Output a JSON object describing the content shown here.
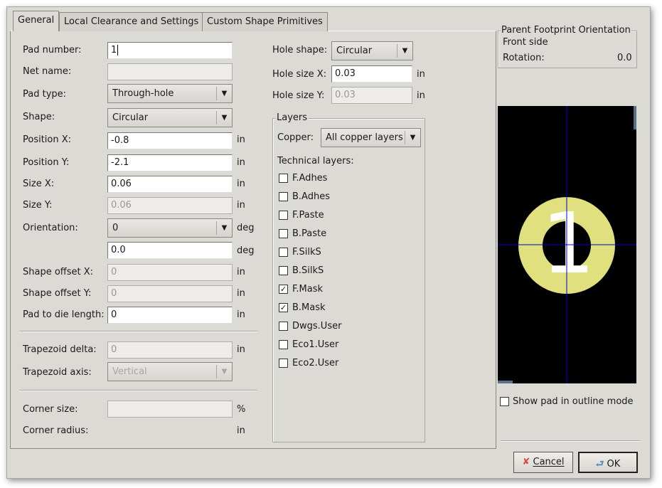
{
  "tabs": [
    "General",
    "Local Clearance and Settings",
    "Custom Shape Primitives"
  ],
  "left": {
    "pad_number": {
      "label": "Pad number:",
      "value": "1"
    },
    "net_name": {
      "label": "Net name:",
      "value": ""
    },
    "pad_type": {
      "label": "Pad type:",
      "value": "Through-hole"
    },
    "shape": {
      "label": "Shape:",
      "value": "Circular"
    },
    "position_x": {
      "label": "Position X:",
      "value": "-0.8",
      "unit": "in"
    },
    "position_y": {
      "label": "Position Y:",
      "value": "-2.1",
      "unit": "in"
    },
    "size_x": {
      "label": "Size X:",
      "value": "0.06",
      "unit": "in"
    },
    "size_y": {
      "label": "Size Y:",
      "value": "0.06",
      "unit": "in"
    },
    "orientation": {
      "label": "Orientation:",
      "value": "0",
      "unit": "deg",
      "custom_value": "0.0",
      "custom_unit": "deg"
    },
    "shape_offset_x": {
      "label": "Shape offset X:",
      "value": "0",
      "unit": "in"
    },
    "shape_offset_y": {
      "label": "Shape offset Y:",
      "value": "0",
      "unit": "in"
    },
    "pad_to_die": {
      "label": "Pad to die length:",
      "value": "0",
      "unit": "in"
    },
    "trapezoid_delta": {
      "label": "Trapezoid delta:",
      "value": "0",
      "unit": "in"
    },
    "trapezoid_axis": {
      "label": "Trapezoid axis:",
      "value": "Vertical"
    },
    "corner_size": {
      "label": "Corner size:",
      "value": "",
      "unit": "%"
    },
    "corner_radius": {
      "label": "Corner radius:",
      "unit": "in"
    }
  },
  "middle": {
    "hole_shape": {
      "label": "Hole shape:",
      "value": "Circular"
    },
    "hole_size_x": {
      "label": "Hole size X:",
      "value": "0.03",
      "unit": "in"
    },
    "hole_size_y": {
      "label": "Hole size Y:",
      "value": "0.03",
      "unit": "in"
    },
    "layers": {
      "title": "Layers",
      "copper_label": "Copper:",
      "copper_value": "All copper layers",
      "technical_label": "Technical layers:",
      "items": [
        {
          "name": "F.Adhes",
          "checked": false
        },
        {
          "name": "B.Adhes",
          "checked": false
        },
        {
          "name": "F.Paste",
          "checked": false
        },
        {
          "name": "B.Paste",
          "checked": false
        },
        {
          "name": "F.SilkS",
          "checked": false
        },
        {
          "name": "B.SilkS",
          "checked": false
        },
        {
          "name": "F.Mask",
          "checked": true
        },
        {
          "name": "B.Mask",
          "checked": true
        },
        {
          "name": "Dwgs.User",
          "checked": false
        },
        {
          "name": "Eco1.User",
          "checked": false
        },
        {
          "name": "Eco2.User",
          "checked": false
        }
      ]
    }
  },
  "right": {
    "orientation_group": {
      "title": "Parent Footprint Orientation",
      "side": "Front side",
      "rotation_label": "Rotation:",
      "rotation_value": "0.0"
    },
    "preview": {
      "pad_label": "1",
      "pad_color": "#e0e07e",
      "background": "#000000",
      "axis_color": "#0000cc"
    },
    "outline_mode": {
      "label": "Show pad in outline mode",
      "checked": false
    }
  },
  "buttons": {
    "cancel": "Cancel",
    "ok": "OK"
  }
}
